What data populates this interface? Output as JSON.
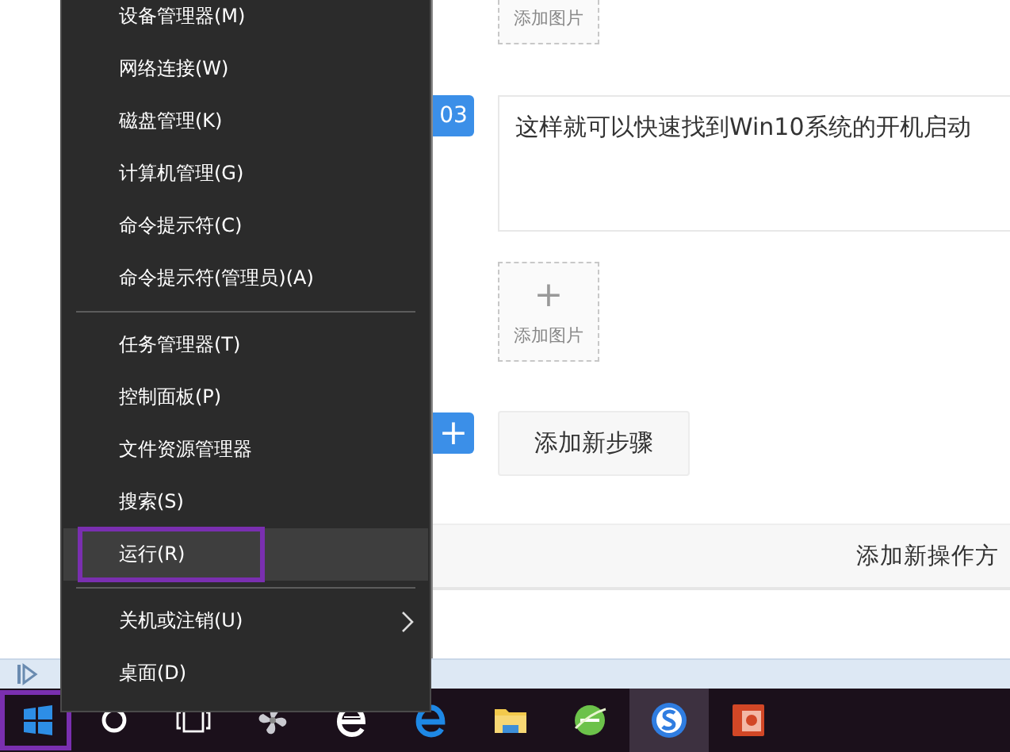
{
  "context_menu": {
    "groups": [
      {
        "items": [
          {
            "label": "设备管理器(M)",
            "selected": false,
            "outlined": false,
            "submenu": false
          },
          {
            "label": "网络连接(W)",
            "selected": false,
            "outlined": false,
            "submenu": false
          },
          {
            "label": "磁盘管理(K)",
            "selected": false,
            "outlined": false,
            "submenu": false
          },
          {
            "label": "计算机管理(G)",
            "selected": false,
            "outlined": false,
            "submenu": false
          },
          {
            "label": "命令提示符(C)",
            "selected": false,
            "outlined": false,
            "submenu": false
          },
          {
            "label": "命令提示符(管理员)(A)",
            "selected": false,
            "outlined": false,
            "submenu": false
          }
        ]
      },
      {
        "items": [
          {
            "label": "任务管理器(T)",
            "selected": false,
            "outlined": false,
            "submenu": false
          },
          {
            "label": "控制面板(P)",
            "selected": false,
            "outlined": false,
            "submenu": false
          },
          {
            "label": "文件资源管理器",
            "selected": false,
            "outlined": false,
            "submenu": false
          },
          {
            "label": "搜索(S)",
            "selected": false,
            "outlined": false,
            "submenu": false
          },
          {
            "label": "运行(R)",
            "selected": true,
            "outlined": true,
            "submenu": false
          }
        ]
      },
      {
        "items": [
          {
            "label": "关机或注销(U)",
            "selected": false,
            "outlined": false,
            "submenu": true
          },
          {
            "label": "桌面(D)",
            "selected": false,
            "outlined": false,
            "submenu": false
          }
        ]
      }
    ]
  },
  "editor": {
    "steps": [
      {
        "kind": "image-only",
        "image_label": "添加图片"
      },
      {
        "kind": "text-step",
        "number": "03",
        "text": "这样就可以快速找到Win10系统的开机启动",
        "image_icon": "+",
        "image_label": "添加图片"
      }
    ],
    "add_step": {
      "icon": "+",
      "label": "添加新步骤"
    },
    "footer_link": "添加新操作方"
  },
  "taskbar": {
    "apps": [
      {
        "kind": "start",
        "selected": false,
        "outlined": true
      },
      {
        "kind": "cortana",
        "selected": false,
        "outlined": false
      },
      {
        "kind": "task-view",
        "selected": false,
        "outlined": false
      },
      {
        "kind": "pinwheel",
        "selected": false,
        "outlined": false
      },
      {
        "kind": "ie",
        "selected": false,
        "outlined": false
      },
      {
        "kind": "edge",
        "selected": false,
        "outlined": false
      },
      {
        "kind": "explorer",
        "selected": false,
        "outlined": false
      },
      {
        "kind": "globe",
        "selected": false,
        "outlined": false
      },
      {
        "kind": "sogou",
        "selected": true,
        "outlined": false
      },
      {
        "kind": "slides",
        "selected": false,
        "outlined": false
      }
    ]
  }
}
